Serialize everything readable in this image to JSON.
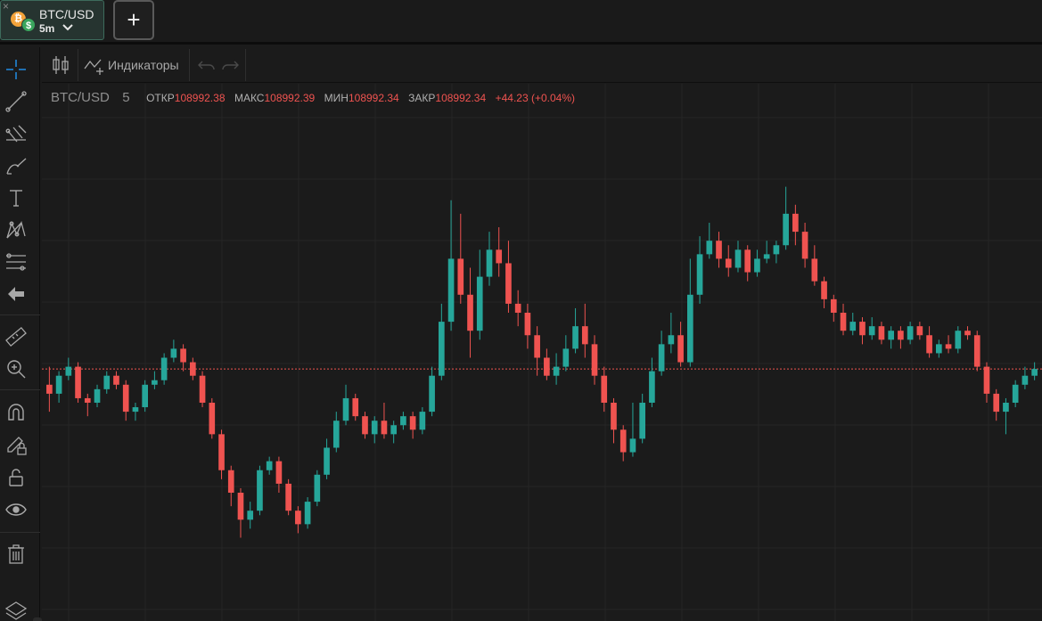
{
  "tab": {
    "close_glyph": "×",
    "symbol": "BTC/USD",
    "interval": "5m",
    "coin_a_glyph": "₿",
    "coin_b_glyph": "$",
    "icons": [
      "btc-coin-icon",
      "usd-coin-icon",
      "chevron-down-icon"
    ]
  },
  "add_tab_glyph": "+",
  "toolbar": {
    "indicators_label": "Индикаторы",
    "icons": [
      "candles-icon",
      "indicators-icon",
      "undo-icon",
      "redo-icon"
    ]
  },
  "left_tools": [
    "crosshair-icon",
    "trend-line-icon",
    "fib-icon",
    "brush-icon",
    "text-icon",
    "pattern-icon",
    "measure-icon",
    "back-arrow-icon",
    "ruler-icon",
    "zoom-in-icon",
    "magnet-icon",
    "pencil-lock-icon",
    "lock-icon",
    "eye-icon",
    "trash-icon",
    "layers-icon"
  ],
  "legend": {
    "symbol": "BTC/USD",
    "interval": "5",
    "open_label": "ОТКР",
    "open_value": "108992.38",
    "high_label": "МАКС",
    "high_value": "108992.39",
    "low_label": "МИН",
    "low_value": "108992.34",
    "close_label": "ЗАКР",
    "close_value": "108992.34",
    "change": "+44.23 (+0.04%)"
  },
  "colors": {
    "up": "#26a69a",
    "down": "#ef5350",
    "background": "#1b1b1b",
    "grid": "#262626",
    "price_line": "#ef5350",
    "accent": "#2196f3"
  },
  "chart_data": {
    "type": "candlestick",
    "symbol": "BTC/USD",
    "interval": "5",
    "y_scale": "relative",
    "ylim": [
      0,
      100
    ],
    "last_price_level": 47.5,
    "candles": [
      [
        44,
        42,
        48,
        38
      ],
      [
        42,
        46,
        47,
        40
      ],
      [
        46,
        48,
        50,
        45
      ],
      [
        48,
        41,
        49,
        40
      ],
      [
        41,
        40,
        42,
        37
      ],
      [
        40,
        43,
        44,
        39
      ],
      [
        43,
        46,
        47,
        42
      ],
      [
        46,
        44,
        47,
        43
      ],
      [
        44,
        38,
        45,
        36
      ],
      [
        38,
        39,
        40,
        36
      ],
      [
        39,
        44,
        45,
        38
      ],
      [
        44,
        45,
        47,
        43
      ],
      [
        45,
        50,
        51,
        44
      ],
      [
        50,
        52,
        54,
        49
      ],
      [
        52,
        49,
        53,
        47
      ],
      [
        49,
        46,
        50,
        45
      ],
      [
        46,
        40,
        47,
        39
      ],
      [
        40,
        33,
        41,
        32
      ],
      [
        33,
        25,
        34,
        23
      ],
      [
        25,
        20,
        26,
        17
      ],
      [
        20,
        14,
        21,
        10
      ],
      [
        14,
        16,
        18,
        12
      ],
      [
        16,
        25,
        26,
        15
      ],
      [
        25,
        27,
        28,
        24
      ],
      [
        27,
        22,
        28,
        20
      ],
      [
        22,
        16,
        23,
        15
      ],
      [
        16,
        13,
        17,
        11
      ],
      [
        13,
        18,
        19,
        12
      ],
      [
        18,
        24,
        25,
        17
      ],
      [
        24,
        30,
        32,
        23
      ],
      [
        30,
        36,
        38,
        29
      ],
      [
        36,
        41,
        44,
        35
      ],
      [
        41,
        37,
        42,
        36
      ],
      [
        37,
        33,
        38,
        32
      ],
      [
        33,
        36,
        37,
        31
      ],
      [
        36,
        33,
        40,
        32
      ],
      [
        33,
        35,
        36,
        31
      ],
      [
        35,
        37,
        38,
        34
      ],
      [
        37,
        34,
        38,
        32
      ],
      [
        34,
        38,
        39,
        33
      ],
      [
        38,
        46,
        48,
        37
      ],
      [
        46,
        58,
        62,
        45
      ],
      [
        58,
        72,
        85,
        56
      ],
      [
        72,
        64,
        82,
        62
      ],
      [
        64,
        56,
        70,
        50
      ],
      [
        56,
        68,
        74,
        54
      ],
      [
        68,
        74,
        78,
        66
      ],
      [
        74,
        71,
        79,
        68
      ],
      [
        71,
        62,
        76,
        60
      ],
      [
        62,
        60,
        65,
        57
      ],
      [
        60,
        55,
        62,
        52
      ],
      [
        55,
        50,
        57,
        46
      ],
      [
        50,
        46,
        52,
        45
      ],
      [
        46,
        48,
        51,
        44
      ],
      [
        48,
        52,
        55,
        47
      ],
      [
        52,
        57,
        61,
        51
      ],
      [
        57,
        53,
        62,
        50
      ],
      [
        53,
        46,
        55,
        44
      ],
      [
        46,
        40,
        48,
        38
      ],
      [
        40,
        34,
        41,
        31
      ],
      [
        34,
        29,
        35,
        27
      ],
      [
        29,
        32,
        40,
        28
      ],
      [
        32,
        40,
        42,
        31
      ],
      [
        40,
        47,
        50,
        39
      ],
      [
        47,
        53,
        56,
        46
      ],
      [
        53,
        55,
        60,
        51
      ],
      [
        55,
        49,
        58,
        48
      ],
      [
        49,
        64,
        72,
        48
      ],
      [
        64,
        73,
        77,
        62
      ],
      [
        73,
        76,
        80,
        72
      ],
      [
        76,
        72,
        78,
        70
      ],
      [
        72,
        70,
        75,
        68
      ],
      [
        70,
        74,
        76,
        69
      ],
      [
        74,
        69,
        75,
        67
      ],
      [
        69,
        72,
        74,
        68
      ],
      [
        72,
        73,
        76,
        71
      ],
      [
        73,
        75,
        76,
        71
      ],
      [
        75,
        82,
        88,
        74
      ],
      [
        82,
        78,
        84,
        75
      ],
      [
        78,
        72,
        80,
        70
      ],
      [
        72,
        67,
        75,
        66
      ],
      [
        67,
        63,
        68,
        61
      ],
      [
        63,
        60,
        64,
        58
      ],
      [
        60,
        56,
        62,
        55
      ],
      [
        56,
        58,
        60,
        55
      ],
      [
        58,
        55,
        59,
        53
      ],
      [
        55,
        57,
        59,
        54
      ],
      [
        57,
        54,
        58,
        53
      ],
      [
        54,
        56,
        57,
        52
      ],
      [
        56,
        54,
        57,
        52
      ],
      [
        54,
        57,
        58,
        53
      ],
      [
        57,
        55,
        58,
        54
      ],
      [
        55,
        51,
        57,
        50
      ],
      [
        51,
        53,
        54,
        50
      ],
      [
        53,
        52,
        55,
        51
      ],
      [
        52,
        56,
        57,
        51
      ],
      [
        56,
        55,
        57,
        54
      ],
      [
        55,
        48,
        56,
        47
      ],
      [
        48,
        42,
        49,
        40
      ],
      [
        42,
        38,
        43,
        36
      ],
      [
        38,
        40,
        41,
        33
      ],
      [
        40,
        44,
        45,
        39
      ],
      [
        44,
        46,
        48,
        43
      ],
      [
        46,
        47.5,
        49,
        45
      ]
    ]
  }
}
